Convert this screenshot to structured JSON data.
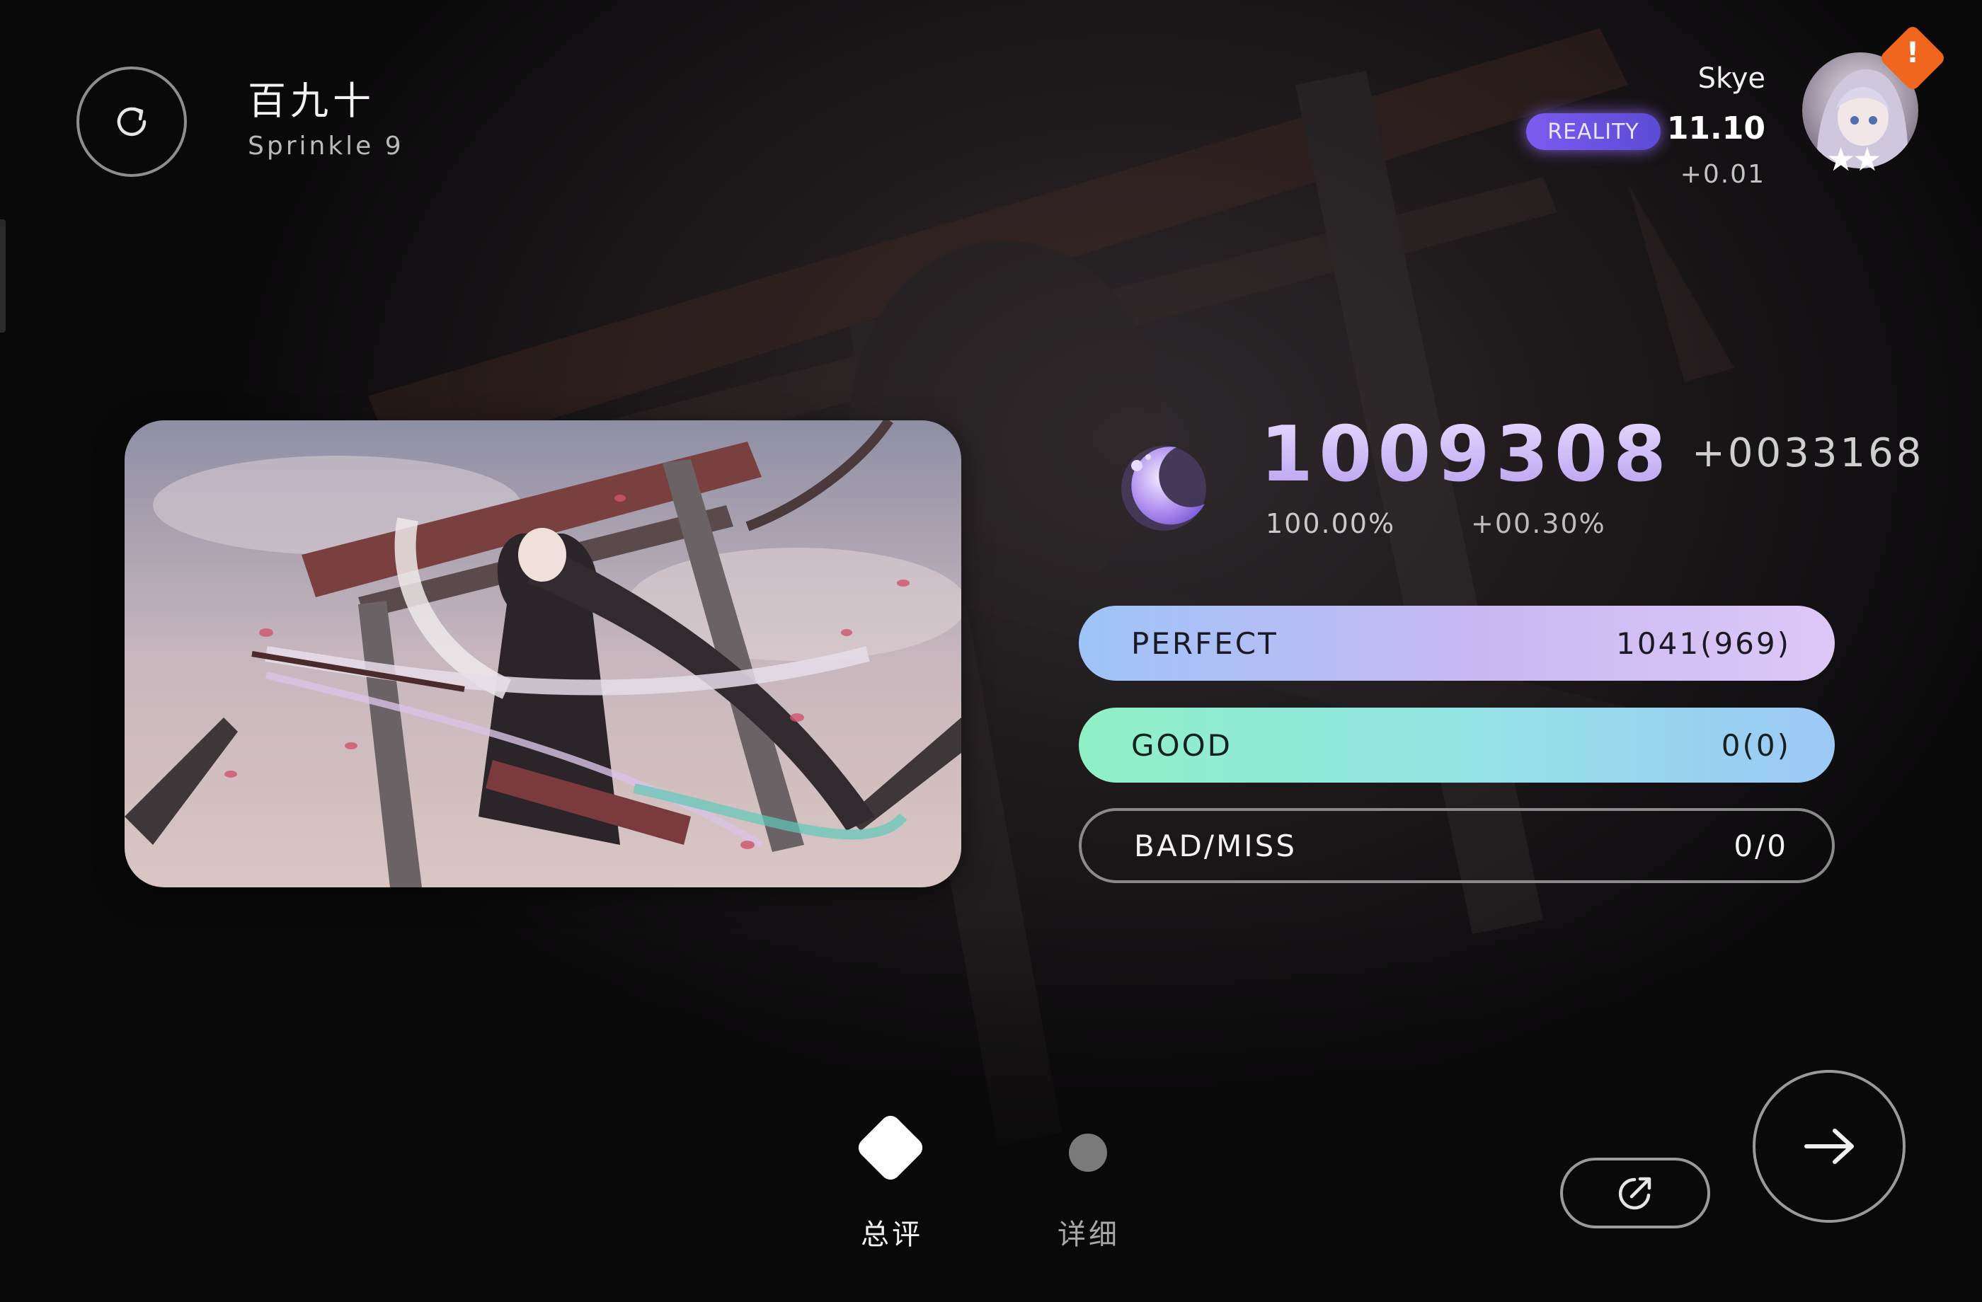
{
  "song": {
    "title": "百九十",
    "level": "Sprinkle 9"
  },
  "player": {
    "name": "Skye",
    "badge": "REALITY",
    "rks": "11.10",
    "rks_delta": "+0.01",
    "avatar_stars": "★★",
    "alert": "!"
  },
  "result": {
    "score": "1009308",
    "score_delta": "+0033168",
    "accuracy": "100.00%",
    "accuracy_delta": "+00.30%"
  },
  "judgements": [
    {
      "label": "PERFECT",
      "value": "1041(969)"
    },
    {
      "label": "GOOD",
      "value": "0(0)"
    },
    {
      "label": "BAD/MISS",
      "value": "0/0"
    }
  ],
  "tabs": [
    {
      "label": "总评",
      "active": true
    },
    {
      "label": "详细",
      "active": false
    }
  ],
  "icons": {
    "retry": "retry-icon",
    "share": "share-icon",
    "next": "arrow-right-icon",
    "rank": "crescent-moon-rank-icon"
  },
  "colors": {
    "accent": "#b79df0",
    "reality_badge": "#6f55e6",
    "alert": "#f0661e"
  }
}
